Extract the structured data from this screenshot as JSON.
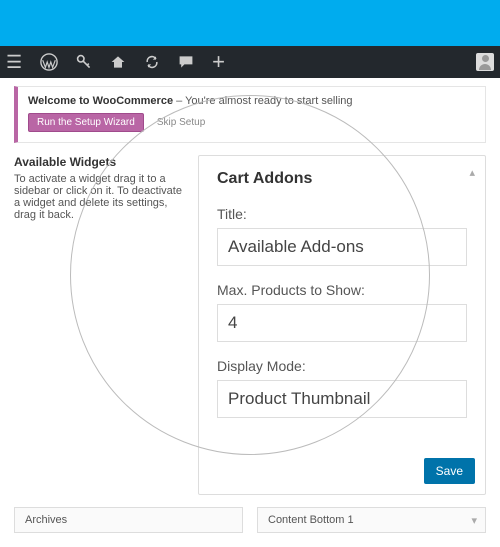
{
  "welcome": {
    "bold": "Welcome to WooCommerce",
    "rest": " – You're almost ready to start selling",
    "setup_button": "Run the Setup Wizard",
    "skip": "Skip Setup"
  },
  "available_widgets": {
    "title": "Available Widgets",
    "help": "To activate a widget drag it to a sidebar or click on it. To deactivate a widget and delete its settings, drag it back."
  },
  "panel": {
    "title": "Cart Addons",
    "title_label": "Title:",
    "title_value": "Available Add-ons",
    "max_label": "Max. Products to Show:",
    "max_value": "4",
    "display_label": "Display Mode:",
    "display_value": "Product Thumbnail",
    "save": "Save"
  },
  "footer": {
    "archives": "Archives",
    "content_bottom": "Content Bottom 1"
  }
}
